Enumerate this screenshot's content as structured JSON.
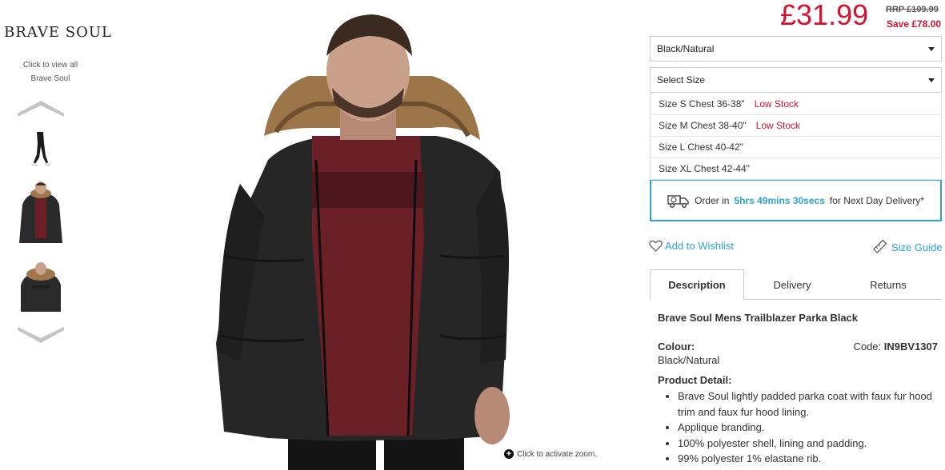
{
  "brand": {
    "name": "BRAVE SOUL",
    "view_all_line1": "Click to view all",
    "view_all_line2": "Brave Soul"
  },
  "gallery": {
    "zoom_hint": "Click to activate zoom.",
    "thumbnail_count": 3
  },
  "pricing": {
    "price": "£31.99",
    "rrp": "RRP £109.99",
    "save": "Save £78.00"
  },
  "colour_select": {
    "selected": "Black/Natural"
  },
  "size_select": {
    "placeholder": "Select Size",
    "options": [
      {
        "label": "Size S Chest 36-38\"",
        "stock": "Low Stock"
      },
      {
        "label": "Size M Chest 38-40\"",
        "stock": "Low Stock"
      },
      {
        "label": "Size L Chest 40-42\"",
        "stock": ""
      },
      {
        "label": "Size XL Chest 42-44\"",
        "stock": ""
      }
    ]
  },
  "delivery": {
    "prefix": "Order in",
    "timer": "5hrs 49mins 30secs",
    "suffix": "for Next Day Delivery*"
  },
  "actions": {
    "wishlist": "Add to Wishlist",
    "size_guide": "Size Guide"
  },
  "tabs": [
    "Description",
    "Delivery",
    "Returns"
  ],
  "description": {
    "title": "Brave Soul Mens Trailblazer Parka Black",
    "colour_label": "Colour:",
    "colour_value": "Black/Natural",
    "code_label": "Code:",
    "code_value": "IN9BV1307",
    "detail_label": "Product Detail:",
    "details": [
      "Brave Soul lightly padded parka coat with faux fur hood trim and faux fur hood lining.",
      "Applique branding.",
      "100% polyester shell, lining and padding.",
      "99% polyester 1% elastane rib."
    ]
  },
  "colors": {
    "accent": "#2ba3d8",
    "sale": "#d2142d"
  }
}
